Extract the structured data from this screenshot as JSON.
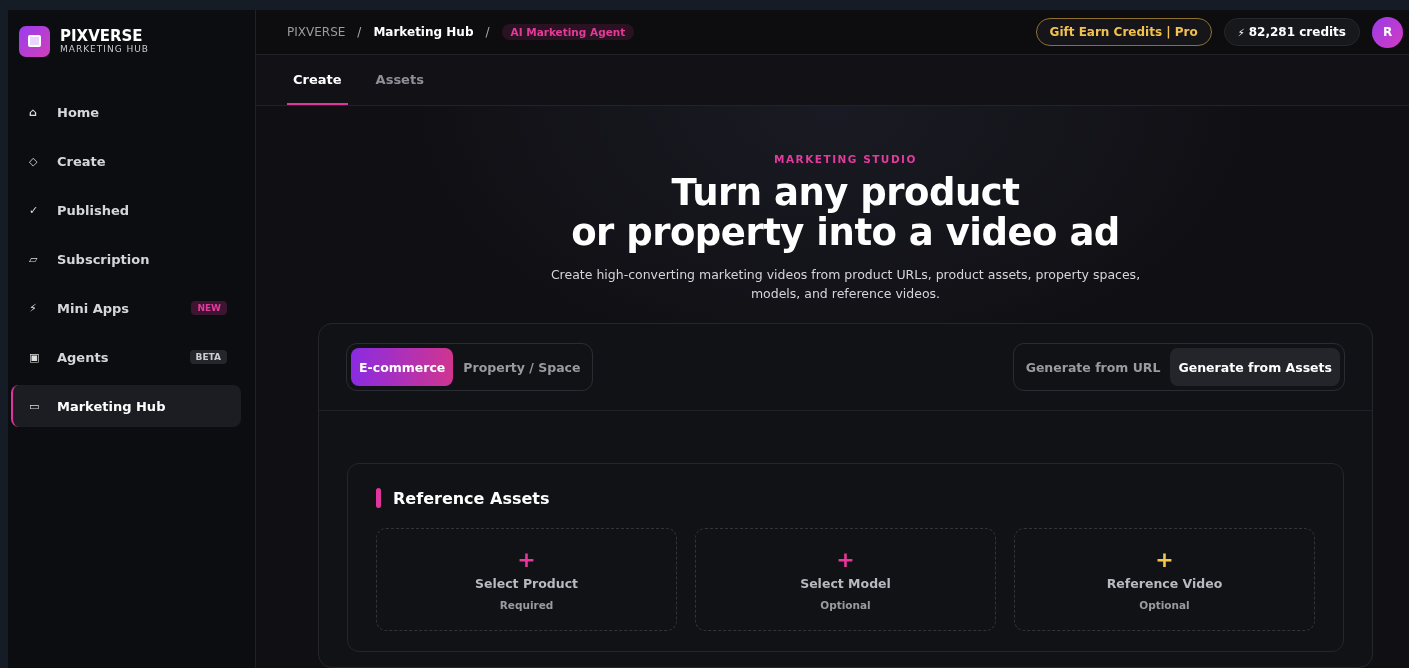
{
  "brand": {
    "name": "PIXVERSE",
    "subtitle": "MARKETING HUB"
  },
  "sidebar": {
    "items": [
      {
        "icon": "⌂",
        "label": "Home",
        "selected": false
      },
      {
        "icon": "◇",
        "label": "Create",
        "selected": false
      },
      {
        "icon": "✓",
        "label": "Published",
        "selected": false
      },
      {
        "icon": "▱",
        "label": "Subscription",
        "selected": false
      },
      {
        "icon": "⚡",
        "label": "Mini Apps",
        "selected": false,
        "badge": {
          "text": "NEW",
          "kind": "accent"
        }
      },
      {
        "icon": "▣",
        "label": "Agents",
        "selected": false,
        "badge": {
          "text": "BETA",
          "kind": "muted"
        }
      },
      {
        "icon": "▭",
        "label": "Marketing Hub",
        "selected": true
      }
    ]
  },
  "breadcrumb": [
    {
      "text": "PIXVERSE",
      "kind": "link"
    },
    {
      "text": "/",
      "kind": "sep"
    },
    {
      "text": "Marketing Hub",
      "kind": "current"
    },
    {
      "text": "/",
      "kind": "sep"
    },
    {
      "text": "AI Marketing Agent",
      "kind": "tag"
    }
  ],
  "header": {
    "gift_button": "Gift Earn Credits | Pro",
    "credits_icon": "⚡",
    "credits": "82,281 credits",
    "avatar": "R"
  },
  "tabs": [
    {
      "label": "Create",
      "selected": true
    },
    {
      "label": "Assets",
      "selected": false
    }
  ],
  "hero": {
    "eyebrow": "MARKETING STUDIO",
    "title_lines": [
      "Turn any product",
      "or property into a video ad"
    ],
    "description": "Create high-converting marketing videos from product URLs, product assets, property spaces, models, and reference videos."
  },
  "mode_toggle": [
    {
      "label": "E-commerce",
      "selected": true
    },
    {
      "label": "Property / Space",
      "selected": false
    }
  ],
  "source_toggle": [
    {
      "label": "Generate from URL",
      "selected": false
    },
    {
      "label": "Generate from Assets",
      "selected": true
    }
  ],
  "reference_assets": {
    "title": "Reference Assets",
    "slots": [
      {
        "icon": "+",
        "color": "#e8369b",
        "label": "Select Product",
        "note": "Required"
      },
      {
        "icon": "+",
        "color": "#e8369b",
        "label": "Select Model",
        "note": "Optional"
      },
      {
        "icon": "+",
        "color": "#f2c84b",
        "label": "Reference Video",
        "note": "Optional"
      }
    ]
  }
}
